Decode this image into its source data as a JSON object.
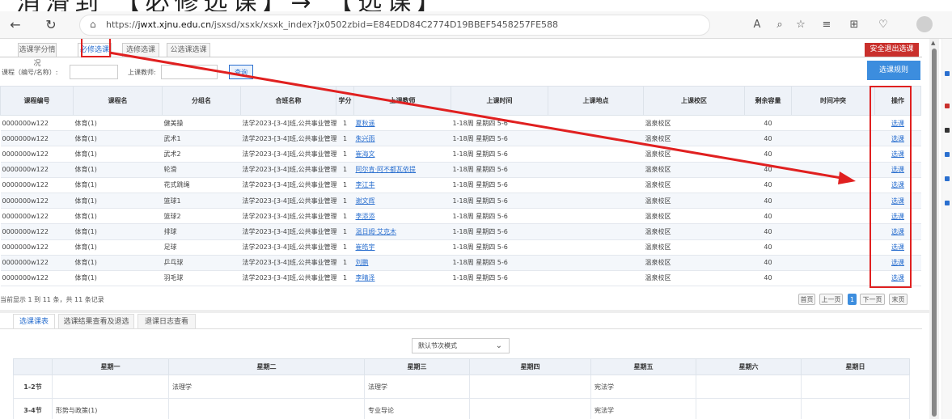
{
  "banner": {
    "text": "消滑到 【必修选课】→ 【选课】"
  },
  "browser": {
    "url_prefix": "https://",
    "url_domain": "jwxt.xjnu.edu.cn",
    "url_path": "/jsxsd/xsxk/xsxk_index?jx0502zbid=E84EDD84C2774D19BBEF5458257FE588"
  },
  "tabs": [
    "选课学分情况",
    "必修选课",
    "选修选课",
    "公选课选课"
  ],
  "exit_label": "安全退出选课",
  "search": {
    "code_label": "课程（编号/名称）:",
    "teacher_label": "上课教师:",
    "query_label": "查询",
    "rules_label": "选课规则"
  },
  "columns": [
    "课程编号",
    "课程名",
    "分组名",
    "合班名称",
    "学分",
    "上课教师",
    "上课时间",
    "上课地点",
    "上课校区",
    "剩余容量",
    "时间冲突",
    "操作"
  ],
  "rows": [
    {
      "code": "0000000w122",
      "name": "体育(1)",
      "group": "健美操",
      "class": "法学2023-[3-4]班,公共事业管理...",
      "credit": "1",
      "teacher": "夏秋遥",
      "time": "1-18周 星期四 5-6",
      "place": "",
      "campus": "温泉校区",
      "remain": "40",
      "conflict": "",
      "op": "选课"
    },
    {
      "code": "0000000w122",
      "name": "体育(1)",
      "group": "武术1",
      "class": "法学2023-[3-4]班,公共事业管理...",
      "credit": "1",
      "teacher": "朱兴雨",
      "time": "1-18周 星期四 5-6",
      "place": "",
      "campus": "温泉校区",
      "remain": "40",
      "conflict": "",
      "op": "选课"
    },
    {
      "code": "0000000w122",
      "name": "体育(1)",
      "group": "武术2",
      "class": "法学2023-[3-4]班,公共事业管理...",
      "credit": "1",
      "teacher": "崔海文",
      "time": "1-18周 星期四 5-6",
      "place": "",
      "campus": "温泉校区",
      "remain": "40",
      "conflict": "",
      "op": "选课"
    },
    {
      "code": "0000000w122",
      "name": "体育(1)",
      "group": "轮滑",
      "class": "法学2023-[3-4]班,公共事业管理...",
      "credit": "1",
      "teacher": "阿尔肯·阿不都瓦依提",
      "time": "1-18周 星期四 5-6",
      "place": "",
      "campus": "温泉校区",
      "remain": "40",
      "conflict": "",
      "op": "选课"
    },
    {
      "code": "0000000w122",
      "name": "体育(1)",
      "group": "花式跳绳",
      "class": "法学2023-[3-4]班,公共事业管理...",
      "credit": "1",
      "teacher": "李江丰",
      "time": "1-18周 星期四 5-6",
      "place": "",
      "campus": "温泉校区",
      "remain": "40",
      "conflict": "",
      "op": "选课"
    },
    {
      "code": "0000000w122",
      "name": "体育(1)",
      "group": "篮球1",
      "class": "法学2023-[3-4]班,公共事业管理...",
      "credit": "1",
      "teacher": "谢文辉",
      "time": "1-18周 星期四 5-6",
      "place": "",
      "campus": "温泉校区",
      "remain": "40",
      "conflict": "",
      "op": "选课"
    },
    {
      "code": "0000000w122",
      "name": "体育(1)",
      "group": "篮球2",
      "class": "法学2023-[3-4]班,公共事业管理...",
      "credit": "1",
      "teacher": "李添添",
      "time": "1-18周 星期四 5-6",
      "place": "",
      "campus": "温泉校区",
      "remain": "40",
      "conflict": "",
      "op": "选课"
    },
    {
      "code": "0000000w122",
      "name": "体育(1)",
      "group": "排球",
      "class": "法学2023-[3-4]班,公共事业管理...",
      "credit": "1",
      "teacher": "温日姆·艾克木",
      "time": "1-18周 星期四 5-6",
      "place": "",
      "campus": "温泉校区",
      "remain": "40",
      "conflict": "",
      "op": "选课"
    },
    {
      "code": "0000000w122",
      "name": "体育(1)",
      "group": "足球",
      "class": "法学2023-[3-4]班,公共事业管理...",
      "credit": "1",
      "teacher": "崔皓宇",
      "time": "1-18周 星期四 5-6",
      "place": "",
      "campus": "温泉校区",
      "remain": "40",
      "conflict": "",
      "op": "选课"
    },
    {
      "code": "0000000w122",
      "name": "体育(1)",
      "group": "乒乓球",
      "class": "法学2023-[3-4]班,公共事业管理...",
      "credit": "1",
      "teacher": "刘鹏",
      "time": "1-18周 星期四 5-6",
      "place": "",
      "campus": "温泉校区",
      "remain": "40",
      "conflict": "",
      "op": "选课"
    },
    {
      "code": "0000000w122",
      "name": "体育(1)",
      "group": "羽毛球",
      "class": "法学2023-[3-4]班,公共事业管理...",
      "credit": "1",
      "teacher": "李晴泽",
      "time": "1-18周 星期四 5-6",
      "place": "",
      "campus": "温泉校区",
      "remain": "40",
      "conflict": "",
      "op": "选课"
    }
  ],
  "footer": {
    "summary": "当前显示 1 到 11 条，共 11 条记录"
  },
  "pager": {
    "first": "首页",
    "prev": "上一页",
    "current": "1",
    "next": "下一页",
    "last": "末页"
  },
  "lower_tabs": [
    "选课课表",
    "选课结果查看及退选",
    "退课日志查看"
  ],
  "mode_select": "默认节次模式",
  "schedule": {
    "days": [
      "星期一",
      "星期二",
      "星期三",
      "星期四",
      "星期五",
      "星期六",
      "星期日"
    ],
    "rows": [
      {
        "period": "1-2节",
        "cells": [
          "",
          "法理学",
          "法理学",
          "",
          "宪法学",
          "",
          ""
        ]
      },
      {
        "period": "3-4节",
        "cells": [
          "形势与政策(1)",
          "",
          "专业导论",
          "",
          "宪法学",
          "",
          ""
        ]
      }
    ]
  },
  "annotation_color": "#e02020"
}
